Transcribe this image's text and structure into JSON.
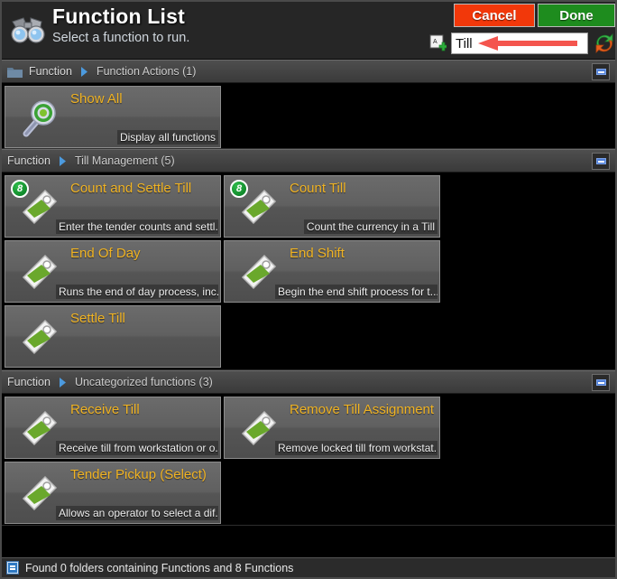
{
  "header": {
    "title": "Function List",
    "subtitle": "Select a function to run.",
    "logo_icon": "binoculars-icon",
    "cancel_label": "Cancel",
    "done_label": "Done",
    "cancel_color": "#f2380a",
    "done_color": "#1e8c1e",
    "add_field_icon": "add-field-icon",
    "refresh_icon": "refresh-icon",
    "search": {
      "value": "Till",
      "placeholder": "",
      "annotation": "red-arrow-pointing-left"
    }
  },
  "groups": [
    {
      "has_folder_icon": true,
      "crumb_root": "Function",
      "crumb_leaf": "Function Actions (1)",
      "collapse_icon": "minus-icon",
      "tiles": [
        {
          "title": "Show All",
          "desc": "Display all functions",
          "icon": "magnifier-icon",
          "badge": ""
        }
      ]
    },
    {
      "has_folder_icon": false,
      "crumb_root": "Function",
      "crumb_leaf": "Till Management (5)",
      "collapse_icon": "minus-icon",
      "tiles": [
        {
          "title": "Count and Settle Till",
          "desc": "Enter the tender counts and settl...",
          "icon": "tag-icon",
          "badge": "8"
        },
        {
          "title": "Count Till",
          "desc": "Count the currency in a Till",
          "icon": "tag-icon",
          "badge": "8"
        },
        {
          "title": "End Of Day",
          "desc": "Runs the end of day process, inc...",
          "icon": "tag-icon",
          "badge": ""
        },
        {
          "title": "End Shift",
          "desc": "Begin the end shift process for t...",
          "icon": "tag-icon",
          "badge": ""
        },
        {
          "title": "Settle Till",
          "desc": "",
          "icon": "tag-icon",
          "badge": ""
        }
      ]
    },
    {
      "has_folder_icon": false,
      "crumb_root": "Function",
      "crumb_leaf": "Uncategorized functions (3)",
      "collapse_icon": "minus-icon",
      "tiles": [
        {
          "title": "Receive Till",
          "desc": "Receive till from workstation or o...",
          "icon": "tag-icon",
          "badge": ""
        },
        {
          "title": "Remove Till Assignment",
          "desc": "Remove locked till from workstat...",
          "icon": "tag-icon",
          "badge": ""
        },
        {
          "title": "Tender Pickup (Select)",
          "desc": "Allows an operator to select a dif...",
          "icon": "tag-icon",
          "badge": ""
        }
      ]
    }
  ],
  "statusbar": {
    "icon": "document-icon",
    "text": "Found 0 folders containing Functions and 8 Functions"
  }
}
